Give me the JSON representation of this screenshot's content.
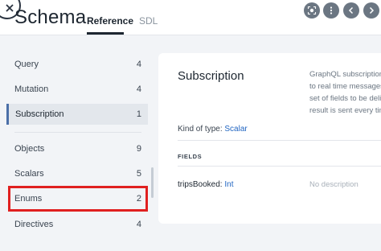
{
  "header": {
    "title": "Schema",
    "tabs": [
      {
        "label": "Reference",
        "active": true
      },
      {
        "label": "SDL",
        "active": false
      }
    ],
    "buttons": [
      "close-icon",
      "focus-icon",
      "more-vertical-icon",
      "chevron-left-icon",
      "chevron-right-icon"
    ]
  },
  "sidebar": {
    "items": [
      {
        "label": "Query",
        "count": "4"
      },
      {
        "label": "Mutation",
        "count": "4"
      },
      {
        "label": "Subscription",
        "count": "1",
        "active": true
      },
      {
        "label": "Objects",
        "count": "9"
      },
      {
        "label": "Scalars",
        "count": "5"
      },
      {
        "label": "Enums",
        "count": "2",
        "highlighted": true
      },
      {
        "label": "Directives",
        "count": "4"
      }
    ]
  },
  "panel": {
    "title": "Subscription",
    "description_lines": [
      "GraphQL subscription",
      "to real time messages",
      "set of fields to be deliv",
      "result is sent every tim"
    ],
    "kind_label": "Kind of type:",
    "kind_value": "Scalar",
    "fields_label": "FIELDS",
    "fields": [
      {
        "name": "tripsBooked:",
        "type": "Int",
        "description": "No description"
      }
    ]
  },
  "colors": {
    "accent": "#4b6fa8",
    "link": "#2266c2",
    "highlight": "#e02020"
  }
}
